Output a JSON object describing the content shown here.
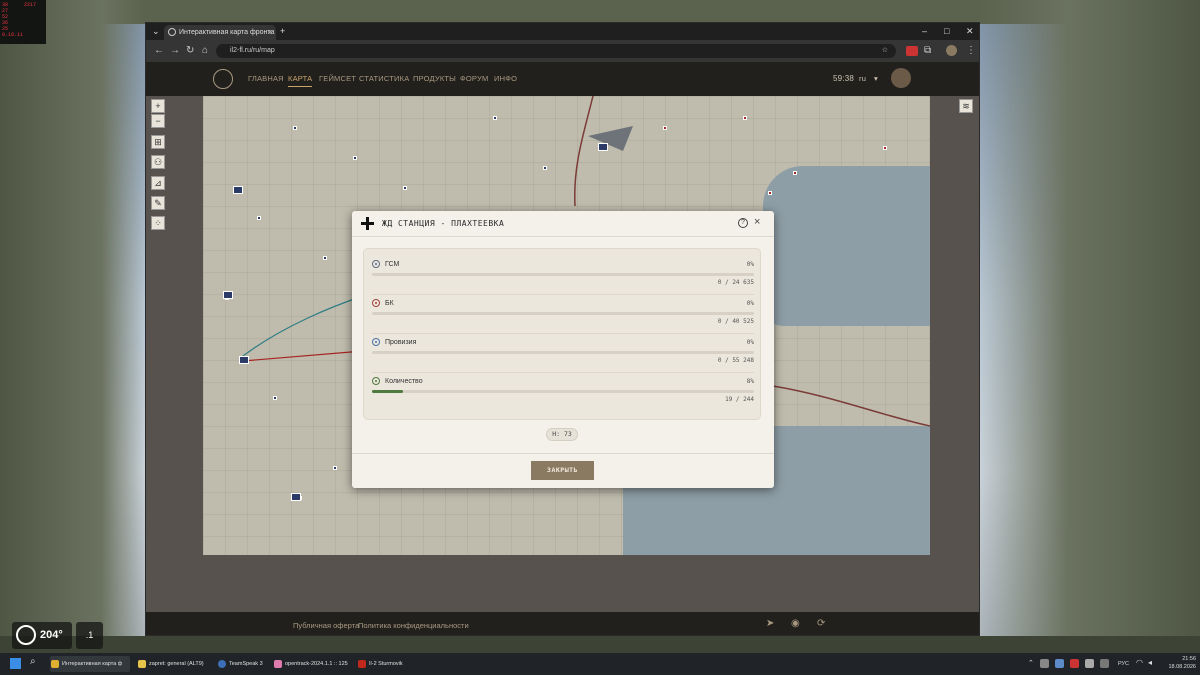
{
  "overlay_stats": [
    "38",
    "27",
    "52",
    "36",
    "25",
    "0.18.11",
    "2217"
  ],
  "browser": {
    "tab_title": "Интерактивная карта фронта",
    "tab_close": "×",
    "new_tab": "+",
    "url": "il2-fl.ru/ru/map"
  },
  "site": {
    "nav": [
      "ГЛАВНАЯ",
      "КАРТА",
      "ГЕЙМСЕТ",
      "СТАТИСТИКА",
      "ПРОДУКТЫ",
      "ФОРУМ",
      "ИНФО"
    ],
    "active_nav": "КАРТА",
    "clock": "59:38",
    "lang": "ru",
    "footer_links": [
      "Публичная оферта",
      "Политика конфиденциальности"
    ]
  },
  "map_controls": {
    "zoom_in": "+",
    "zoom_out": "−"
  },
  "modal": {
    "title": "ЖД СТАНЦИЯ - ПЛАХТЕЕВКА",
    "help": "?",
    "close_x": "×",
    "resources": [
      {
        "label": "ГСМ",
        "percent": "0%",
        "count": "0 / 24 635",
        "fill_fraction": 0,
        "color": "#5d6a86"
      },
      {
        "label": "БК",
        "percent": "0%",
        "count": "0 / 40 525",
        "fill_fraction": 0,
        "color": "#a5433f"
      },
      {
        "label": "Провизия",
        "percent": "0%",
        "count": "0 / 55 248",
        "fill_fraction": 0,
        "color": "#4a72a8"
      },
      {
        "label": "Количество",
        "percent": "8%",
        "count": "19 / 244",
        "fill_fraction": 0.08,
        "color": "#4f7a3f"
      }
    ],
    "height_badge": "H: 73",
    "close_button": "ЗАКРЫТЬ"
  },
  "hud": {
    "heading": "204°",
    "vario": ".1"
  },
  "taskbar": {
    "items": [
      "Интерактивная карта ф",
      "zapret: general (ALT9)",
      "TeamSpeak 3",
      "opentrack-2024.1.1 :: 125",
      "Il-2 Sturmovik"
    ],
    "lang": "РУС",
    "time": "21:56",
    "date": "18.08.2026"
  }
}
